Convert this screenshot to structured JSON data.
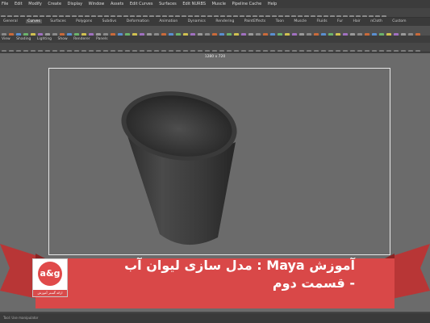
{
  "menubar": [
    "File",
    "Edit",
    "Modify",
    "Create",
    "Display",
    "Window",
    "Assets",
    "Edit Curves",
    "Surfaces",
    "Edit NURBS",
    "Muscle",
    "Pipeline Cache",
    "Help"
  ],
  "shelf_tabs": [
    "General",
    "Curves",
    "Surfaces",
    "Polygons",
    "Subdivs",
    "Deformation",
    "Animation",
    "Dynamics",
    "Rendering",
    "PaintEffects",
    "Toon",
    "Muscle",
    "Fluids",
    "Fur",
    "Hair",
    "nCloth",
    "Custom"
  ],
  "shelf_active": "Curves",
  "panel_menu": [
    "View",
    "Shading",
    "Lighting",
    "Show",
    "Renderer",
    "Panels"
  ],
  "viewport": {
    "resolution_label": "1280 x 720"
  },
  "helpline": "Tool: Use manipulator",
  "banner": {
    "title": "آموزش Maya : مدل سازی لیوان آب",
    "subtitle": "- قسمت دوم",
    "color": "#d94848"
  },
  "logo": {
    "mark": "a&g",
    "caption": "ارائه گستر آموزش"
  }
}
